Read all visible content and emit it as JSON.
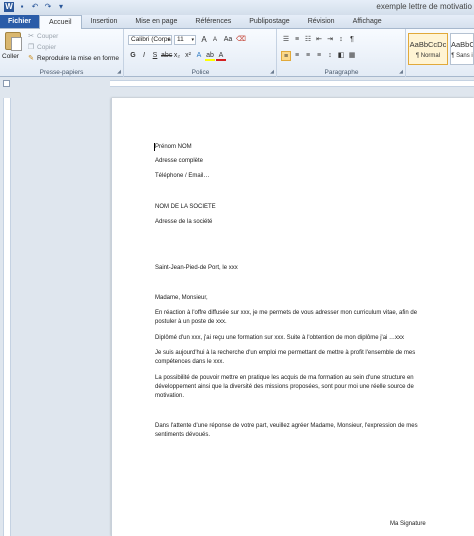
{
  "window": {
    "title": "exemple lettre de motivatio"
  },
  "tabs": [
    "Fichier",
    "Accueil",
    "Insertion",
    "Mise en page",
    "Références",
    "Publipostage",
    "Révision",
    "Affichage"
  ],
  "clipboard": {
    "paste": "Coller",
    "cut": "Couper",
    "copy": "Copier",
    "format_painter": "Reproduire la mise en forme",
    "group_label": "Presse-papiers"
  },
  "font": {
    "name": "Calibri (Corps",
    "size": "11",
    "group_label": "Police",
    "bold": "G",
    "italic": "I",
    "underline": "S",
    "font_color_letter": "A",
    "grow_letter": "A",
    "shrink_letter": "A",
    "case_label": "Aa"
  },
  "paragraph": {
    "group_label": "Paragraphe"
  },
  "styles": [
    {
      "preview": "AaBbCcDc",
      "name": "¶ Normal",
      "selected": true
    },
    {
      "preview": "AaBbCcDc",
      "name": "¶ Sans i",
      "selected": false
    }
  ],
  "icons": {
    "save": "floppy-icon",
    "undo": "undo-icon",
    "redo": "redo-icon",
    "paste": "clipboard-icon",
    "cut": "scissors-icon",
    "copy": "copy-icon",
    "painter": "paintbrush-icon"
  },
  "document": {
    "lines": [
      "Prénom NOM",
      "Adresse complète",
      "Téléphone / Email…",
      "NOM DE LA SOCIETE",
      "Adresse de la société",
      "Saint-Jean-Pied-de Port, le xxx",
      "Madame, Monsieur,",
      "En réaction à l'offre diffusée sur xxx, je me permets de vous adresser mon curriculum vitae, afin de",
      "postuler à un poste de xxx.",
      "Diplômé d'un xxx, j'ai reçu une formation sur xxx. Suite à l'obtention de mon diplôme j'ai …xxx",
      "Je suis aujourd'hui à la recherche d'un emploi me permettant de mettre à profit l'ensemble de mes",
      "compétences dans le xxx.",
      "La possibilité de pouvoir mettre en pratique les acquis de ma formation au sein d'une structure en",
      "développement ainsi que la diversité des missions proposées, sont pour moi une réelle source de",
      "motivation.",
      "Dans l'attente d'une réponse de votre part, veuillez agréer Madame, Monsieur, l'expression de mes",
      "sentiments dévoués.",
      "Ma Signature"
    ]
  }
}
